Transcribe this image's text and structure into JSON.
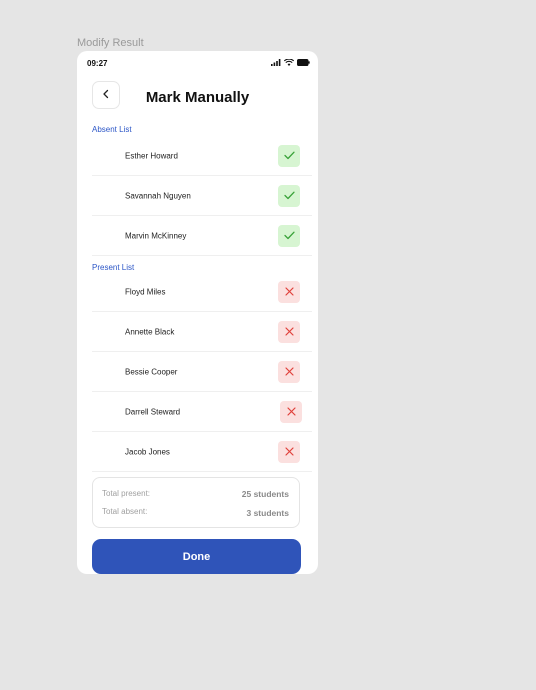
{
  "frame_label": "Modify Result",
  "status_bar": {
    "time": "09:27"
  },
  "header": {
    "title": "Mark Manually"
  },
  "absent_section": {
    "label": "Absent List",
    "students": [
      {
        "name": "Esther Howard",
        "action_icon": "check-icon"
      },
      {
        "name": "Savannah Nguyen",
        "action_icon": "check-icon"
      },
      {
        "name": "Marvin McKinney",
        "action_icon": "check-icon"
      }
    ]
  },
  "present_section": {
    "label": "Present List",
    "students": [
      {
        "name": "Floyd Miles",
        "action_icon": "close-icon"
      },
      {
        "name": "Annette Black",
        "action_icon": "close-icon"
      },
      {
        "name": "Bessie Cooper",
        "action_icon": "close-icon"
      },
      {
        "name": "Darrell Steward",
        "action_icon": "close-icon"
      },
      {
        "name": "Jacob Jones",
        "action_icon": "close-icon"
      }
    ]
  },
  "summary": {
    "present_label": "Total present:",
    "present_value": "25 students",
    "absent_label": "Total absent:",
    "absent_value": "3 students"
  },
  "done_label": "Done",
  "colors": {
    "accent": "#2f54b9",
    "section_label": "#2c56c7",
    "check_bg": "#d7f5d2",
    "check_fg": "#3aa33a",
    "cross_bg": "#fbe0df",
    "cross_fg": "#e0403a"
  }
}
